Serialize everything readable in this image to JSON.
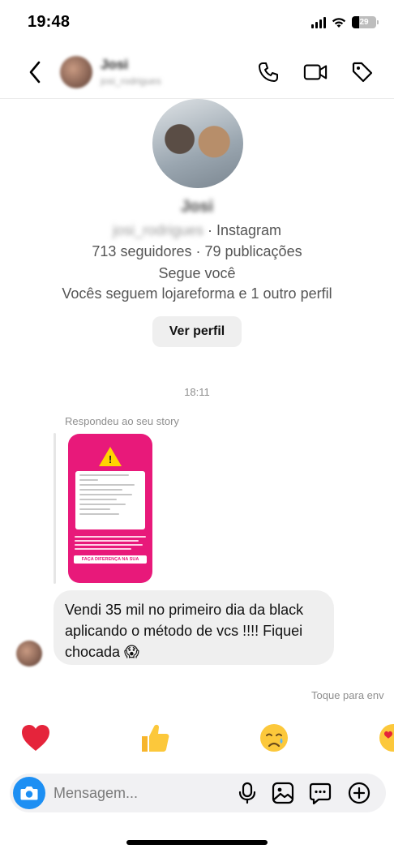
{
  "status_bar": {
    "time": "19:48",
    "battery": "29"
  },
  "header": {
    "contact_name": "Josi",
    "contact_username": "josi_rodrigues"
  },
  "profile": {
    "name": "Josi",
    "handle": "josi_rodrigues",
    "platform": "· Instagram",
    "stats": "713 seguidores · 79 publicações",
    "follows_you": "Segue você",
    "mutuals": "Vocês seguem lojareforma e 1 outro perfil",
    "view_profile_label": "Ver perfil"
  },
  "conversation": {
    "timestamp": "18:11",
    "story_reply_label": "Respondeu ao seu story",
    "story_banner": "FAÇA DIFERENÇA NA SUA LOJA!!!",
    "message_text": "Vendi 35 mil no primeiro dia da black aplicando o método de vcs !!!! Fiquei chocada 😱",
    "tap_to_send": "Toque para env"
  },
  "reactions": [
    "❤️",
    "👍",
    "😢",
    "😍"
  ],
  "composer": {
    "placeholder": "Mensagem..."
  },
  "colors": {
    "accent": "#1d8ff3",
    "story_pink": "#e8197a",
    "bubble": "#efefef"
  }
}
